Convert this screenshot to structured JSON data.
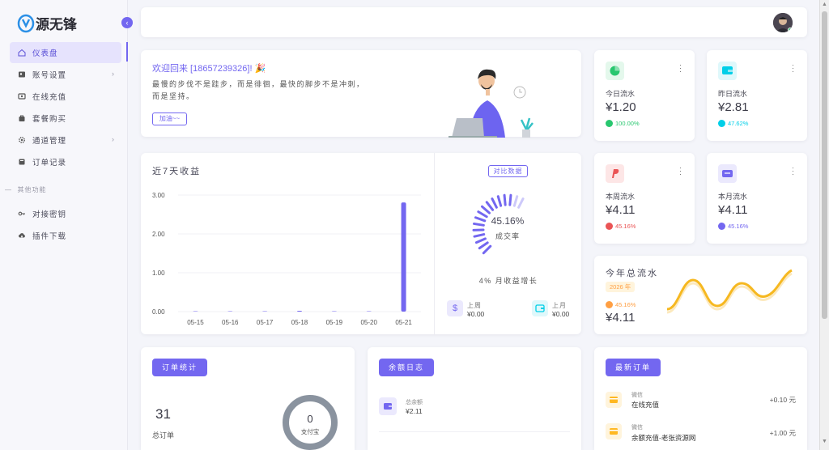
{
  "brand": {
    "logo_text": "源无锋"
  },
  "sidebar": {
    "items": [
      {
        "label": "仪表盘",
        "icon": "home-icon",
        "active": true
      },
      {
        "label": "账号设置",
        "icon": "user-card-icon",
        "chevron": true
      },
      {
        "label": "在线充值",
        "icon": "wallet-icon"
      },
      {
        "label": "套餐购买",
        "icon": "shopping-bag-icon"
      },
      {
        "label": "通道管理",
        "icon": "gear-icon",
        "chevron": true
      },
      {
        "label": "订单记录",
        "icon": "document-icon"
      }
    ],
    "section_title": "其他功能",
    "items2": [
      {
        "label": "对接密钥",
        "icon": "key-icon"
      },
      {
        "label": "插件下载",
        "icon": "cloud-download-icon"
      }
    ]
  },
  "welcome": {
    "title": "欢迎回来 [18657239326]! 🎉",
    "line1": "最慢的步伐不是跬步，而是徘徊，最快的脚步不是冲刺，",
    "line2": "而是坚持。",
    "button": "加油~~"
  },
  "stats": [
    {
      "label": "今日流水",
      "value": "¥1.20",
      "pct": "100.00%",
      "color": "#28c76f",
      "bg": "#e4f8ec"
    },
    {
      "label": "昨日流水",
      "value": "¥2.81",
      "pct": "47.62%",
      "color": "#00cfe8",
      "bg": "#dff8fb"
    },
    {
      "label": "本周流水",
      "value": "¥4.11",
      "pct": "45.16%",
      "color": "#ea5455",
      "bg": "#fde6e6"
    },
    {
      "label": "本月流水",
      "value": "¥4.11",
      "pct": "45.16%",
      "color": "#7367f0",
      "bg": "#ebe9fd"
    }
  ],
  "revenue": {
    "title": "近7天收益",
    "compare_button": "对比数据",
    "gauge_value": "45.16%",
    "gauge_label": "成交率",
    "growth": "4% 月收益增长",
    "last_week_label": "上周",
    "last_week_value": "¥0.00",
    "last_month_label": "上月",
    "last_month_value": "¥0.00"
  },
  "chart_data": {
    "type": "bar",
    "title": "近7天收益",
    "categories": [
      "05-15",
      "05-16",
      "05-17",
      "05-18",
      "05-19",
      "05-20",
      "05-21"
    ],
    "values": [
      0,
      0,
      0,
      0.01,
      0,
      0,
      2.81
    ],
    "yticks": [
      "0.00",
      "1.00",
      "2.00",
      "3.00"
    ],
    "ylim": [
      0,
      3
    ],
    "color": "#7367f0",
    "grid": true
  },
  "total": {
    "title": "今年总流水",
    "year": "2026 年",
    "pct": "45.16%",
    "value": "¥4.11"
  },
  "orders": {
    "title": "订单统计",
    "count": "31",
    "count_label": "总订单",
    "donut_value": "0",
    "donut_label": "支付宝"
  },
  "balance": {
    "title": "余额日志",
    "label": "总余额",
    "value": "¥2.11"
  },
  "latest": {
    "title": "最新订单",
    "rows": [
      {
        "channel": "微信",
        "name": "在线充值",
        "amount": "+0.10 元"
      },
      {
        "channel": "微信",
        "name": "余额充值-老张资源网",
        "amount": "+1.00 元"
      }
    ]
  },
  "colors": {
    "accent": "#7367f0",
    "success": "#28c76f",
    "info": "#00cfe8",
    "danger": "#ea5455",
    "warning": "#ffb822"
  }
}
